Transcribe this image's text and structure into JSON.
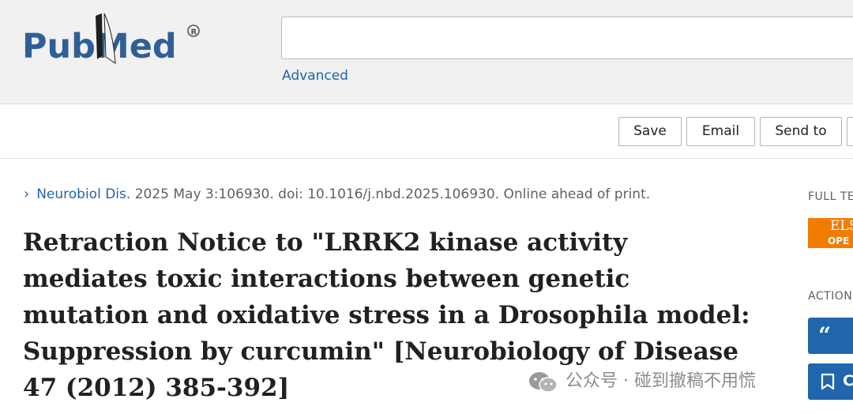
{
  "header": {
    "logo_text": "PubMed",
    "search": {
      "value": "",
      "placeholder": ""
    },
    "advanced_label": "Advanced"
  },
  "actions_bar": {
    "save_label": "Save",
    "email_label": "Email",
    "send_to_label": "Send to"
  },
  "article": {
    "journal": "Neurobiol Dis.",
    "citation_rest": "2025 May 3:106930. doi: 10.1016/j.nbd.2025.106930. Online ahead of print.",
    "title": "Retraction Notice to \"LRRK2 kinase activity mediates toxic interactions between genetic mutation and oxidative stress in a Drosophila model: Suppression by curcumin\" [Neurobiology of Disease 47 (2012) 385-392]"
  },
  "sidebar": {
    "full_text_label": "FULL TE",
    "publisher_badge": {
      "top": "ELS",
      "bottom": "OPE"
    },
    "actions_label": "ACTION",
    "cite_symbol": "“",
    "collections_label": "C"
  },
  "watermark": {
    "text": "公众号 · 碰到撤稿不用慌"
  },
  "colors": {
    "brand_blue": "#2066ad",
    "header_bg": "#f1f1f1",
    "elsevier_orange": "#f07d00",
    "title_text": "#212121",
    "muted_text": "#5b616b"
  }
}
